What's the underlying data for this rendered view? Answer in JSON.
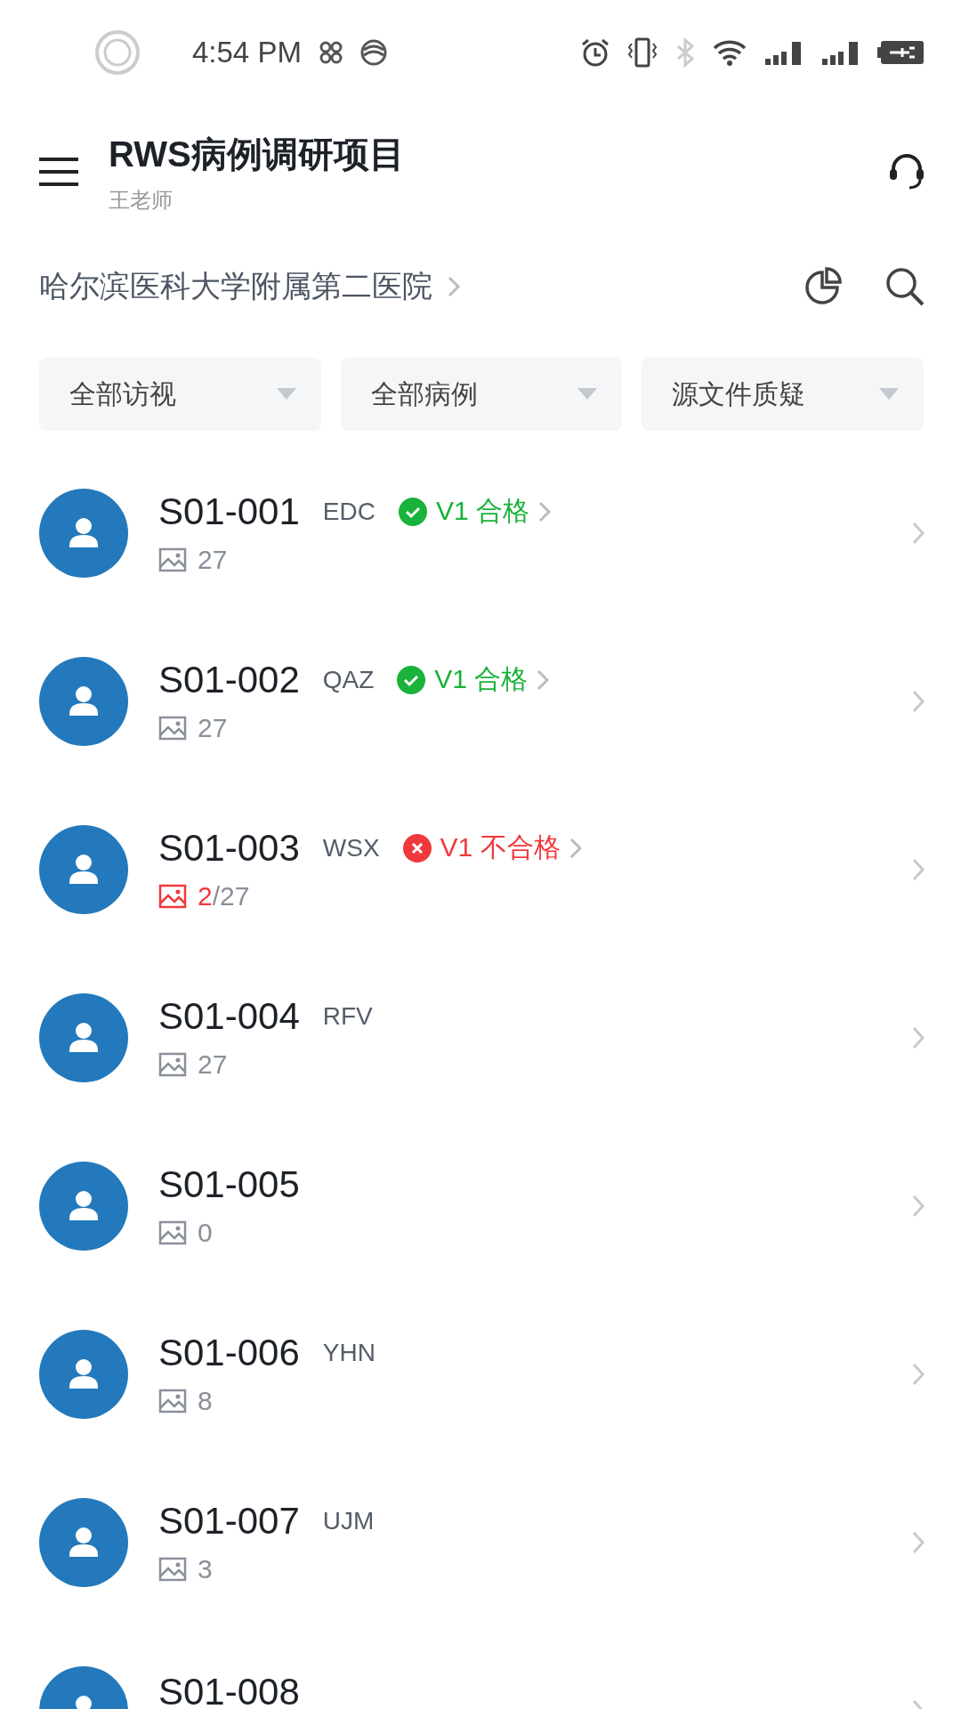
{
  "status_bar": {
    "time": "4:54 PM"
  },
  "header": {
    "title": "RWS病例调研项目",
    "subtitle": "王老师"
  },
  "site": {
    "name": "哈尔滨医科大学附属第二医院"
  },
  "filters": [
    {
      "label": "全部访视"
    },
    {
      "label": "全部病例"
    },
    {
      "label": "源文件质疑"
    }
  ],
  "cases": [
    {
      "code": "S01-001",
      "tag": "EDC",
      "status": {
        "kind": "pass",
        "label": "V1 合格"
      },
      "images": {
        "count": "27"
      }
    },
    {
      "code": "S01-002",
      "tag": "QAZ",
      "status": {
        "kind": "pass",
        "label": "V1 合格"
      },
      "images": {
        "count": "27"
      }
    },
    {
      "code": "S01-003",
      "tag": "WSX",
      "status": {
        "kind": "fail",
        "label": "V1 不合格"
      },
      "images": {
        "flagged": "2",
        "count": "/27"
      }
    },
    {
      "code": "S01-004",
      "tag": "RFV",
      "images": {
        "count": "27"
      }
    },
    {
      "code": "S01-005",
      "images": {
        "count": "0"
      }
    },
    {
      "code": "S01-006",
      "tag": "YHN",
      "images": {
        "count": "8"
      }
    },
    {
      "code": "S01-007",
      "tag": "UJM",
      "images": {
        "count": "3"
      }
    },
    {
      "code": "S01-008"
    }
  ]
}
